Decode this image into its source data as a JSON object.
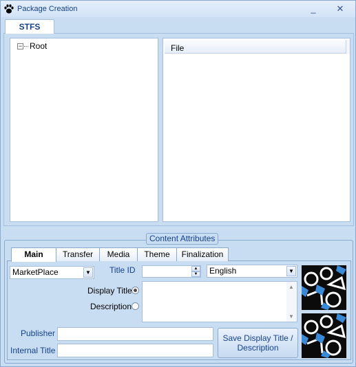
{
  "window": {
    "title": "Package Creation",
    "minimize_glyph": "_",
    "close_glyph": "✕",
    "icon": "paw-icon"
  },
  "top_tabs": {
    "stfs_label": "STFS"
  },
  "tree": {
    "root_label": "Root",
    "expander_glyph": "−"
  },
  "file_list": {
    "column_file": "File"
  },
  "content_attributes": {
    "legend": "Content Attributes",
    "tabs": [
      "Main",
      "Transfer",
      "Media",
      "Theme",
      "Finalization"
    ],
    "active_tab": "Main",
    "package_type": "MarketPlace",
    "title_id_label": "Title ID",
    "title_id_value": "",
    "language": "English",
    "display_title_label": "Display Title",
    "description_label": "Description",
    "display_title_selected": true,
    "text_value": "",
    "publisher_label": "Publisher",
    "publisher_value": "",
    "internal_title_label": "Internal Title",
    "internal_title_value": "",
    "save_button_label": "Save Display Title / Description"
  },
  "colors": {
    "window_bg": "#c8dcf2",
    "border": "#8aa9cf",
    "accent_text": "#15428b"
  }
}
